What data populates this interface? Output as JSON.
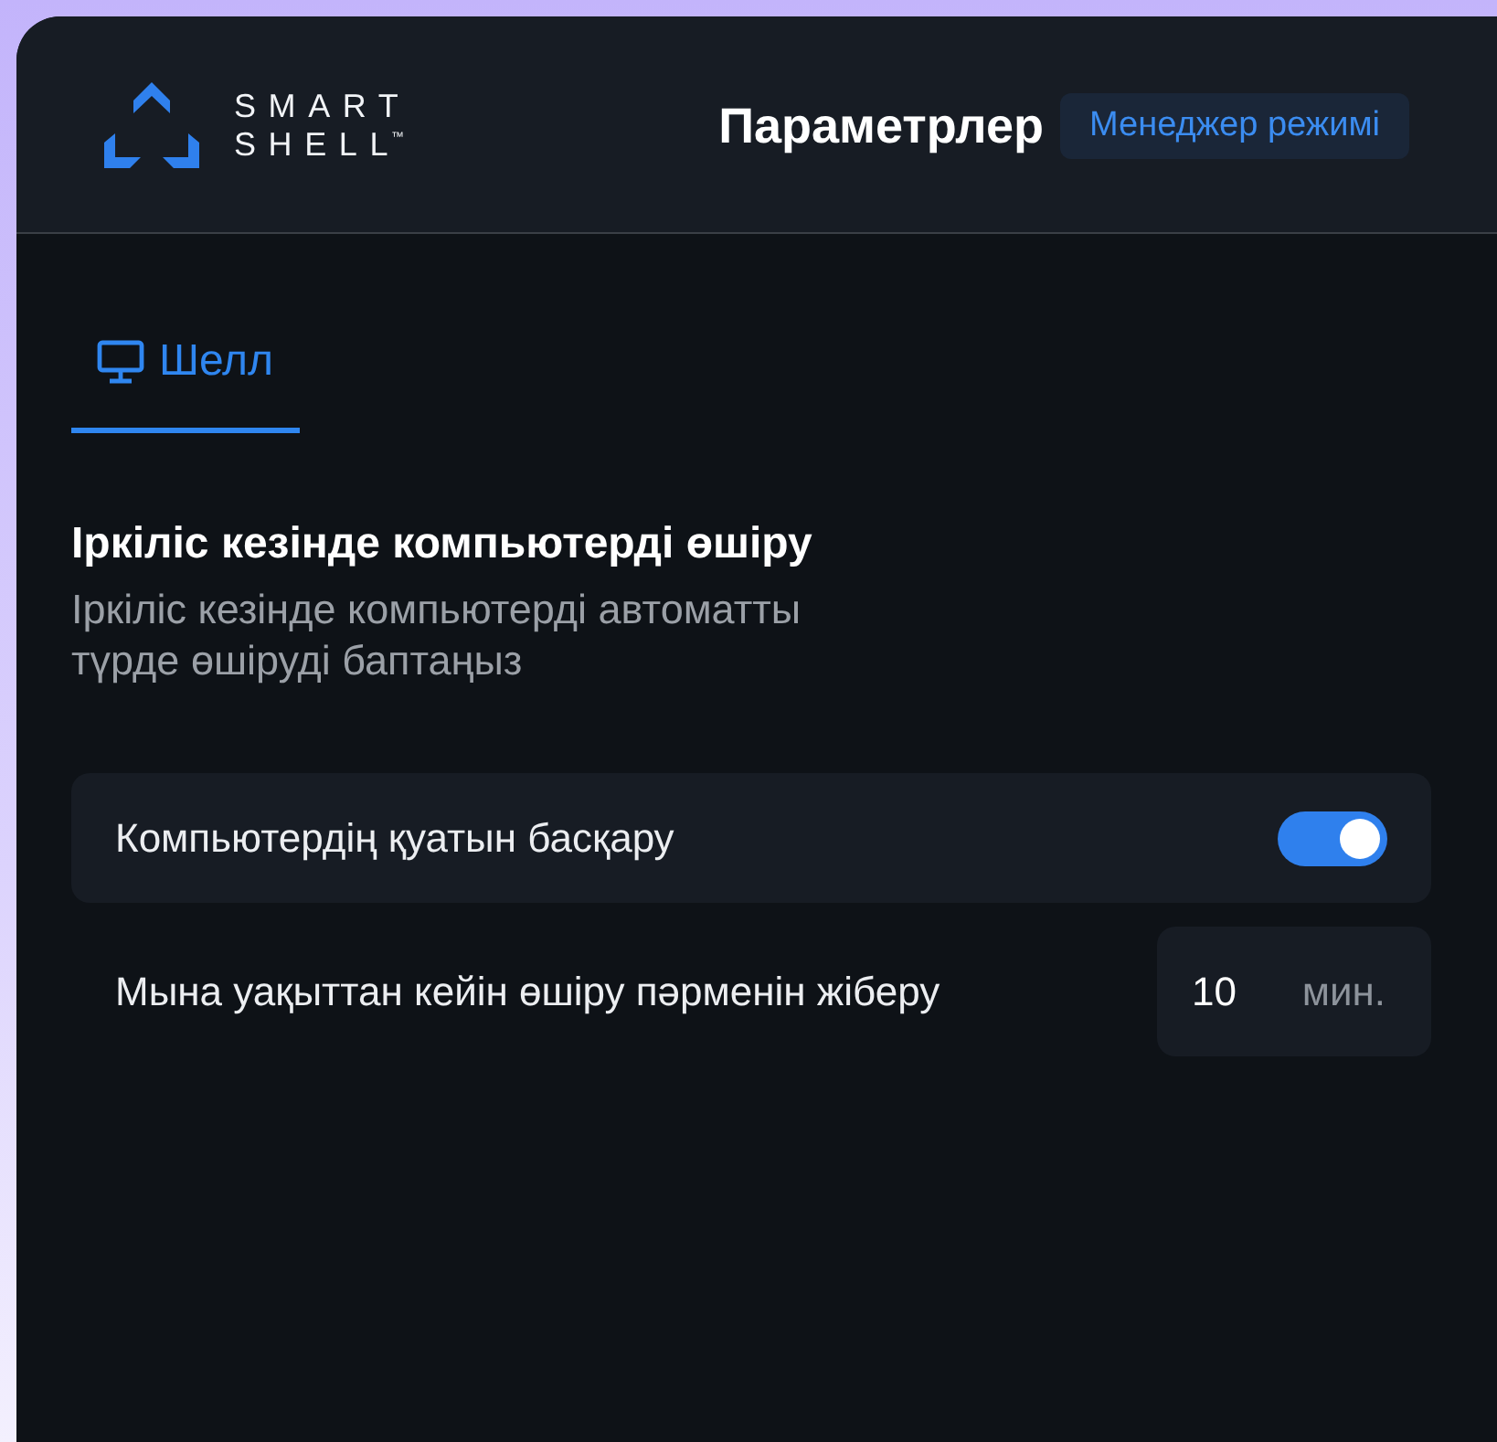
{
  "header": {
    "logo": {
      "line_1": "SMART",
      "line_2": "SHELL",
      "trademark": "™"
    },
    "title": "Параметрлер",
    "badge": "Менеджер режимі"
  },
  "tabs": [
    {
      "label": "Шелл",
      "selected": true
    }
  ],
  "section": {
    "title": "Іркіліс кезінде компьютерді өшіру",
    "description": "Іркіліс кезінде компьютерді автоматты түрде өшіруді баптаңыз"
  },
  "settings": [
    {
      "kind": "toggle",
      "label": "Компьютердің қуатын басқару",
      "on": true
    },
    {
      "kind": "number",
      "label": "Мына уақыттан кейін өшіру пәрменін жіберу",
      "value": "10",
      "unit": "мин."
    }
  ]
}
